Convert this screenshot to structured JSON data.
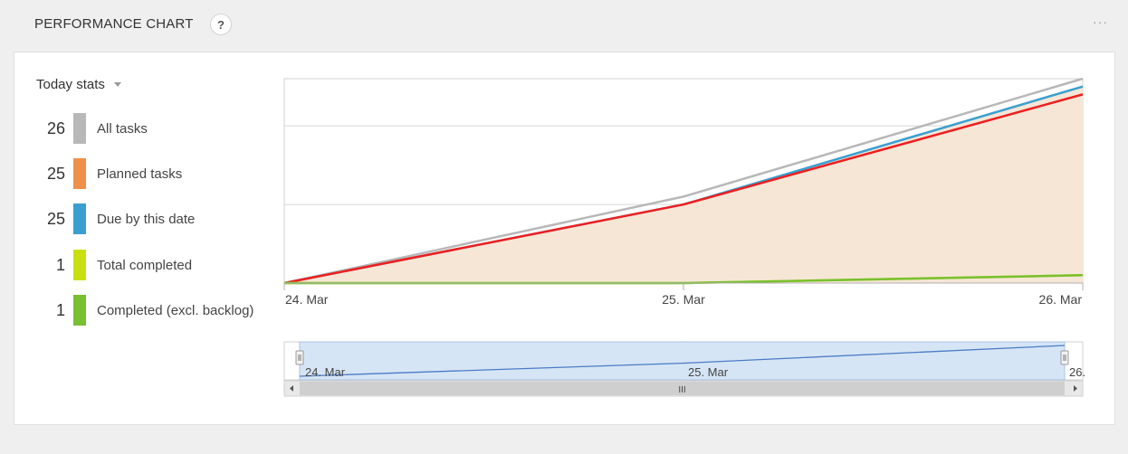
{
  "header": {
    "title": "PERFORMANCE CHART",
    "help_label": "?",
    "more_label": "···"
  },
  "panel": {
    "dropdown_label": "Today stats"
  },
  "legend": [
    {
      "count": "26",
      "label": "All tasks",
      "color": "#b8b8b8"
    },
    {
      "count": "25",
      "label": "Planned tasks",
      "color": "#f0904a"
    },
    {
      "count": "25",
      "label": "Due by this date",
      "color": "#3a9fd0"
    },
    {
      "count": "1",
      "label": "Total completed",
      "color": "#c8e010"
    },
    {
      "count": "1",
      "label": "Completed (excl. backlog)",
      "color": "#78c030"
    }
  ],
  "chart_data": {
    "type": "line",
    "x": [
      "24. Mar",
      "25. Mar",
      "26. Mar"
    ],
    "ylim": [
      0,
      26
    ],
    "yticks": [
      "0",
      "10",
      "20"
    ],
    "grid": true,
    "series": [
      {
        "name": "Planned tasks",
        "kind": "area",
        "values": [
          0,
          10,
          25
        ],
        "color": "#f6e6d6"
      },
      {
        "name": "All tasks",
        "values": [
          0,
          11,
          26
        ],
        "color": "#b8b8b8"
      },
      {
        "name": "Due by this date",
        "values": [
          0,
          10,
          25
        ],
        "color": "#3a9fd0"
      },
      {
        "values": [
          0,
          10,
          24
        ],
        "color": "#ee1f1f"
      },
      {
        "name": "Total completed",
        "values": [
          0,
          0,
          1
        ],
        "color": "#c8e010"
      },
      {
        "name": "Completed (excl. backlog)",
        "values": [
          0,
          0,
          1
        ],
        "color": "#78c030"
      }
    ],
    "navigator": {
      "x_labels": [
        "24. Mar",
        "25. Mar",
        "26."
      ],
      "scrollbar_label": "III"
    }
  }
}
